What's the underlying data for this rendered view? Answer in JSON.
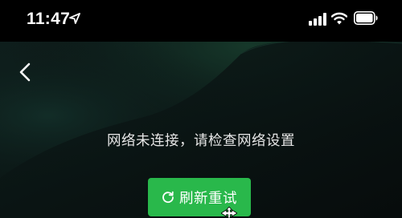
{
  "status_bar": {
    "time": "11:47",
    "icons": [
      "location-arrow-icon",
      "cellular-signal-icon",
      "wifi-icon",
      "battery-icon"
    ]
  },
  "nav": {
    "back_icon": "chevron-left-icon"
  },
  "error": {
    "message": "网络未连接，请检查网络设置"
  },
  "retry_button": {
    "icon": "refresh-icon",
    "label": "刷新重试"
  },
  "colors": {
    "background": "#000000",
    "accent_green": "#29b84b",
    "text": "#e6e6e6"
  }
}
